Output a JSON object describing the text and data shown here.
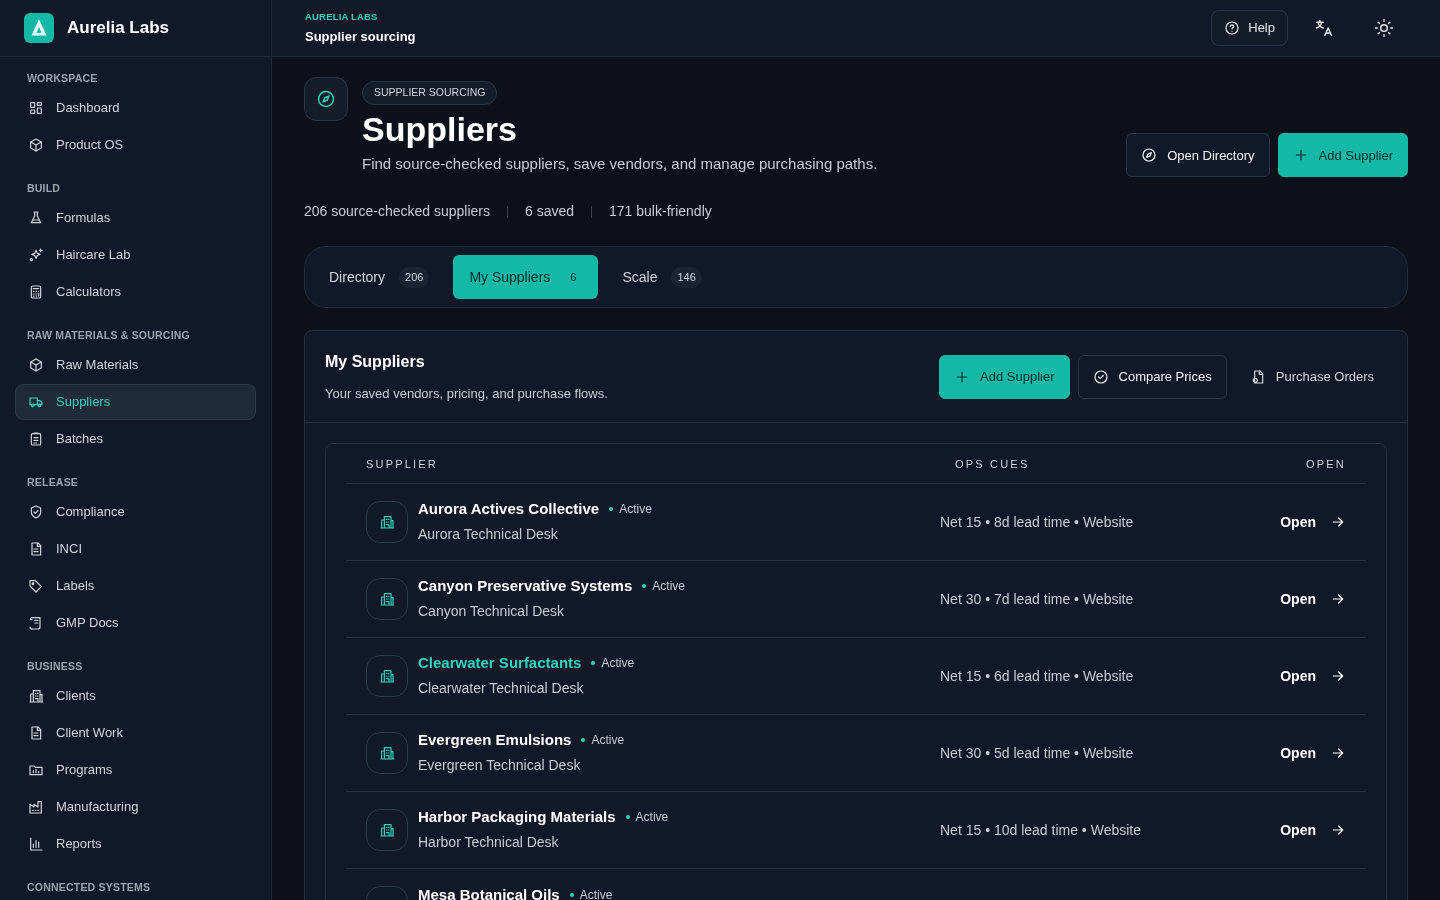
{
  "brand": {
    "name": "Aurelia Labs"
  },
  "sidebar": {
    "sections": [
      {
        "label": "WORKSPACE",
        "items": [
          {
            "label": "Dashboard",
            "selected": false
          },
          {
            "label": "Product OS",
            "selected": false
          }
        ]
      },
      {
        "label": "BUILD",
        "items": [
          {
            "label": "Formulas",
            "selected": false
          },
          {
            "label": "Haircare Lab",
            "selected": false
          },
          {
            "label": "Calculators",
            "selected": false
          }
        ]
      },
      {
        "label": "RAW MATERIALS & SOURCING",
        "items": [
          {
            "label": "Raw Materials",
            "selected": false
          },
          {
            "label": "Suppliers",
            "selected": true
          },
          {
            "label": "Batches",
            "selected": false
          }
        ]
      },
      {
        "label": "RELEASE",
        "items": [
          {
            "label": "Compliance",
            "selected": false
          },
          {
            "label": "INCI",
            "selected": false
          },
          {
            "label": "Labels",
            "selected": false
          },
          {
            "label": "GMP Docs",
            "selected": false
          }
        ]
      },
      {
        "label": "BUSINESS",
        "items": [
          {
            "label": "Clients",
            "selected": false
          },
          {
            "label": "Client Work",
            "selected": false
          },
          {
            "label": "Programs",
            "selected": false
          },
          {
            "label": "Manufacturing",
            "selected": false
          },
          {
            "label": "Reports",
            "selected": false
          }
        ]
      },
      {
        "label": "CONNECTED SYSTEMS"
      }
    ]
  },
  "topbar": {
    "eyebrow": "AURELIA LABS",
    "title": "Supplier sourcing",
    "help": "Help"
  },
  "hero": {
    "badge": "SUPPLIER SOURCING",
    "title": "Suppliers",
    "subtitle": "Find source-checked suppliers, save vendors, and manage purchasing paths.",
    "buttons": [
      {
        "label": "Open Directory",
        "kind": "secondary"
      },
      {
        "label": "Add Supplier",
        "kind": "primary"
      }
    ]
  },
  "stats": [
    "206 source-checked suppliers",
    "6 saved",
    "171 bulk-friendly"
  ],
  "tabs": [
    {
      "label": "Directory",
      "count": "206",
      "selected": false
    },
    {
      "label": "My Suppliers",
      "count": "6",
      "selected": true
    },
    {
      "label": "Scale",
      "count": "146",
      "selected": false
    }
  ],
  "panel": {
    "title": "My Suppliers",
    "subtitle": "Your saved vendors, pricing, and purchase flows.",
    "buttons": [
      {
        "label": "Add Supplier",
        "kind": "primary"
      },
      {
        "label": "Compare Prices",
        "kind": "secondary"
      },
      {
        "label": "Purchase Orders",
        "kind": "ghost"
      }
    ],
    "table": {
      "columns": [
        "SUPPLIER",
        "OPS CUES",
        "OPEN"
      ],
      "rows": [
        {
          "name": "Aurora Actives Collective",
          "status": "Active",
          "desk": "Aurora Technical Desk",
          "cues": "Net 15 • 8d lead time • Website",
          "action": "Open",
          "highlighted": false
        },
        {
          "name": "Canyon Preservative Systems",
          "status": "Active",
          "desk": "Canyon Technical Desk",
          "cues": "Net 30 • 7d lead time • Website",
          "action": "Open",
          "highlighted": false
        },
        {
          "name": "Clearwater Surfactants",
          "status": "Active",
          "desk": "Clearwater Technical Desk",
          "cues": "Net 15 • 6d lead time • Website",
          "action": "Open",
          "highlighted": true
        },
        {
          "name": "Evergreen Emulsions",
          "status": "Active",
          "desk": "Evergreen Technical Desk",
          "cues": "Net 30 • 5d lead time • Website",
          "action": "Open",
          "highlighted": false
        },
        {
          "name": "Harbor Packaging Materials",
          "status": "Active",
          "desk": "Harbor Technical Desk",
          "cues": "Net 15 • 10d lead time • Website",
          "action": "Open",
          "highlighted": false
        },
        {
          "name": "Mesa Botanical Oils",
          "status": "Active",
          "highlighted": false
        }
      ]
    }
  }
}
